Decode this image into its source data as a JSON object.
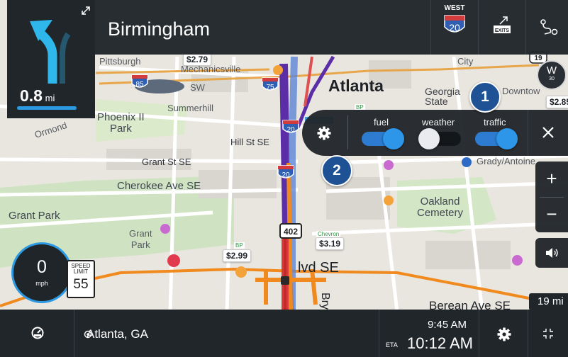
{
  "top_bar": {
    "city": "Birmingham",
    "direction_label": "WEST",
    "interstate_number": "20",
    "exits_label": "EXITS"
  },
  "turn": {
    "distance_value": "0.8",
    "distance_unit": "mi",
    "progress": 0.85
  },
  "map": {
    "labels": {
      "pittsburgh": "Pittsburgh",
      "mechanicsville": "Mechanicsville",
      "atlanta": "Atlanta",
      "georgia_state": "Georgia\nState",
      "downtown": "Downtow",
      "summerhill": "Summerhill",
      "phoenix_park": "Phoenix II\nPark",
      "ormond": "Ormond",
      "sw": "SW",
      "hill_st": "Hill St SE",
      "grant_st": "Grant St SE",
      "cherokee": "Cherokee Ave SE",
      "grant_park": "Grant Park",
      "grant_park_2": "Grant\nPark",
      "oakland_cemetery": "Oakland\nCemetery",
      "grady": "Grady/Antoine",
      "city": "City",
      "blvd": "lvd SE",
      "berean": "Berean Ave SE",
      "bry": "Bry"
    },
    "prices": {
      "p1": "$2.79",
      "p2": "$2.99",
      "p3": "$3.19",
      "p4": "$2.85"
    },
    "brands": {
      "bp1": "BP",
      "bp2": "BP",
      "chevron": "Chevron"
    },
    "shields": {
      "i85": "85",
      "i75": "75",
      "i20a": "20",
      "i20b": "20",
      "us19": "19",
      "route402": "402"
    }
  },
  "compass": {
    "heading": "W",
    "degrees": "30"
  },
  "quick_settings": {
    "toggles": [
      {
        "label": "fuel",
        "state": "on"
      },
      {
        "label": "weather",
        "state": "off"
      },
      {
        "label": "traffic",
        "state": "on"
      }
    ],
    "callouts": [
      "1",
      "2"
    ]
  },
  "zoom": {
    "in": "+",
    "out": "−"
  },
  "speed": {
    "value": "0",
    "unit": "mph",
    "limit_label": "SPEED\nLIMIT",
    "limit": "55"
  },
  "remaining": "19 mi",
  "bottom_bar": {
    "destination": "Atlanta, GA",
    "clock": "9:45 AM",
    "eta_label": "ETA",
    "eta_time": "10:12 AM"
  },
  "colors": {
    "panel": "#21262b",
    "accent": "#2c9ae3",
    "route_orange": "#f08a1e",
    "route_purple": "#5b2ea8",
    "callout": "#1f5195"
  },
  "icons": [
    "turn-left-arrow-icon",
    "expand-icon",
    "exits-icon",
    "route-icon",
    "gear-icon",
    "close-icon",
    "volume-icon",
    "dashboard-icon",
    "location-icon",
    "fullscreen-icon"
  ]
}
